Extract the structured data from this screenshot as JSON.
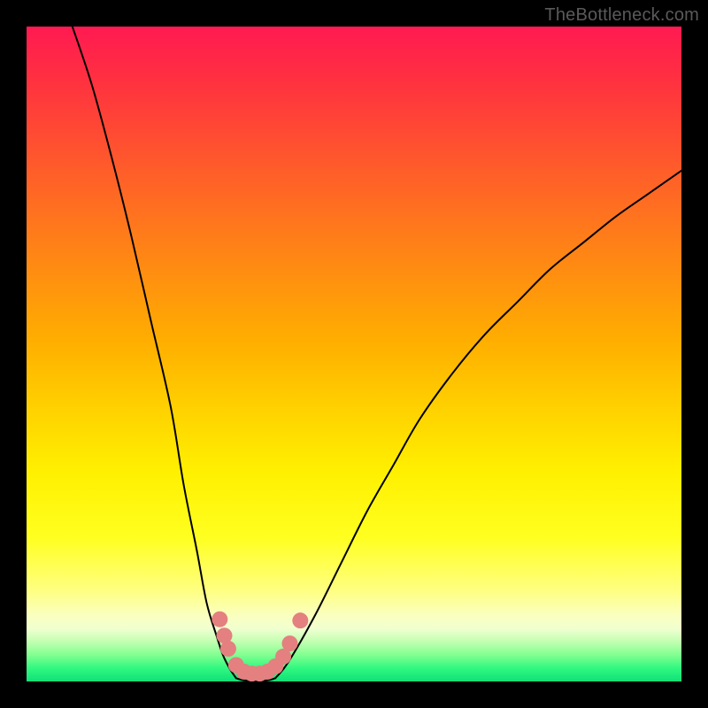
{
  "watermark": "TheBottleneck.com",
  "chart_data": {
    "type": "line",
    "title": "",
    "xlabel": "",
    "ylabel": "",
    "xlim": [
      0,
      100
    ],
    "ylim": [
      0,
      100
    ],
    "grid": false,
    "legend": false,
    "background_gradient": {
      "top": "red",
      "middle": "yellow",
      "bottom": "green"
    },
    "series": [
      {
        "name": "left-curve",
        "color": "#000000",
        "width": 2,
        "x": [
          7,
          10,
          13,
          16,
          19,
          22,
          24,
          26,
          27.5,
          29,
          30,
          31,
          32
        ],
        "y": [
          100,
          91,
          80,
          68,
          55,
          42,
          30,
          20,
          12,
          7,
          4,
          2,
          0.5
        ]
      },
      {
        "name": "right-curve",
        "color": "#000000",
        "width": 2,
        "x": [
          38,
          40,
          44,
          48,
          52,
          56,
          60,
          65,
          70,
          75,
          80,
          85,
          90,
          95,
          100
        ],
        "y": [
          0.5,
          3,
          10,
          18,
          26,
          33,
          40,
          47,
          53,
          58,
          63,
          67,
          71,
          74.5,
          78
        ]
      },
      {
        "name": "valley-floor",
        "color": "#000000",
        "width": 2,
        "x": [
          32,
          33,
          34,
          35,
          36,
          37,
          38
        ],
        "y": [
          0.5,
          0.2,
          0.1,
          0.1,
          0.1,
          0.2,
          0.5
        ]
      }
    ],
    "markers": [
      {
        "name": "valley-dots-pink",
        "color": "#e48080",
        "radius": 9,
        "points": [
          {
            "x": 29.5,
            "y": 9.5
          },
          {
            "x": 30.2,
            "y": 7.0
          },
          {
            "x": 30.8,
            "y": 5.0
          },
          {
            "x": 32.0,
            "y": 2.5
          },
          {
            "x": 33.2,
            "y": 1.5
          },
          {
            "x": 34.4,
            "y": 1.2
          },
          {
            "x": 35.6,
            "y": 1.2
          },
          {
            "x": 36.8,
            "y": 1.5
          },
          {
            "x": 38.0,
            "y": 2.3
          },
          {
            "x": 39.2,
            "y": 3.8
          },
          {
            "x": 40.2,
            "y": 5.8
          },
          {
            "x": 41.8,
            "y": 9.3
          }
        ]
      }
    ]
  }
}
